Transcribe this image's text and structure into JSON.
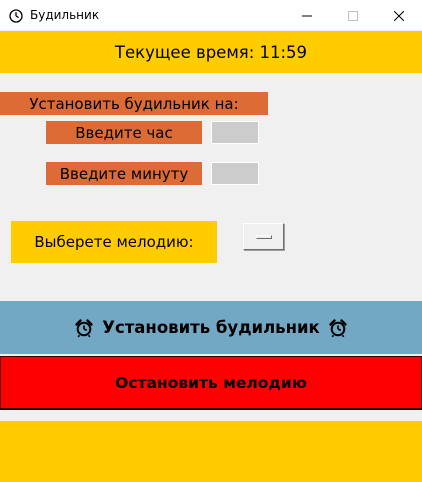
{
  "window": {
    "title": "Будильник",
    "icon": "clock-icon",
    "controls": [
      "minimize-icon",
      "maximize-icon",
      "close-icon"
    ]
  },
  "time_bar": {
    "text": "Текущее время: 11:59"
  },
  "alarm_form": {
    "set_alarm_label": "Установить будильник на:",
    "hour_label": "Введите час",
    "hour_value": "",
    "minute_label": "Введите минуту",
    "minute_value": ""
  },
  "melody": {
    "label": "Выберете мелодию:",
    "selected": ""
  },
  "buttons": {
    "set_alarm": "Установить будильник",
    "set_alarm_icon": "alarm-clock-icon",
    "stop_melody": "Остановить мелодию"
  },
  "colors": {
    "yellow": "#ffcc00",
    "orange": "#dc6b35",
    "blue": "#72a8c4",
    "red": "#ff0000",
    "entry_bg": "#cccccc"
  }
}
